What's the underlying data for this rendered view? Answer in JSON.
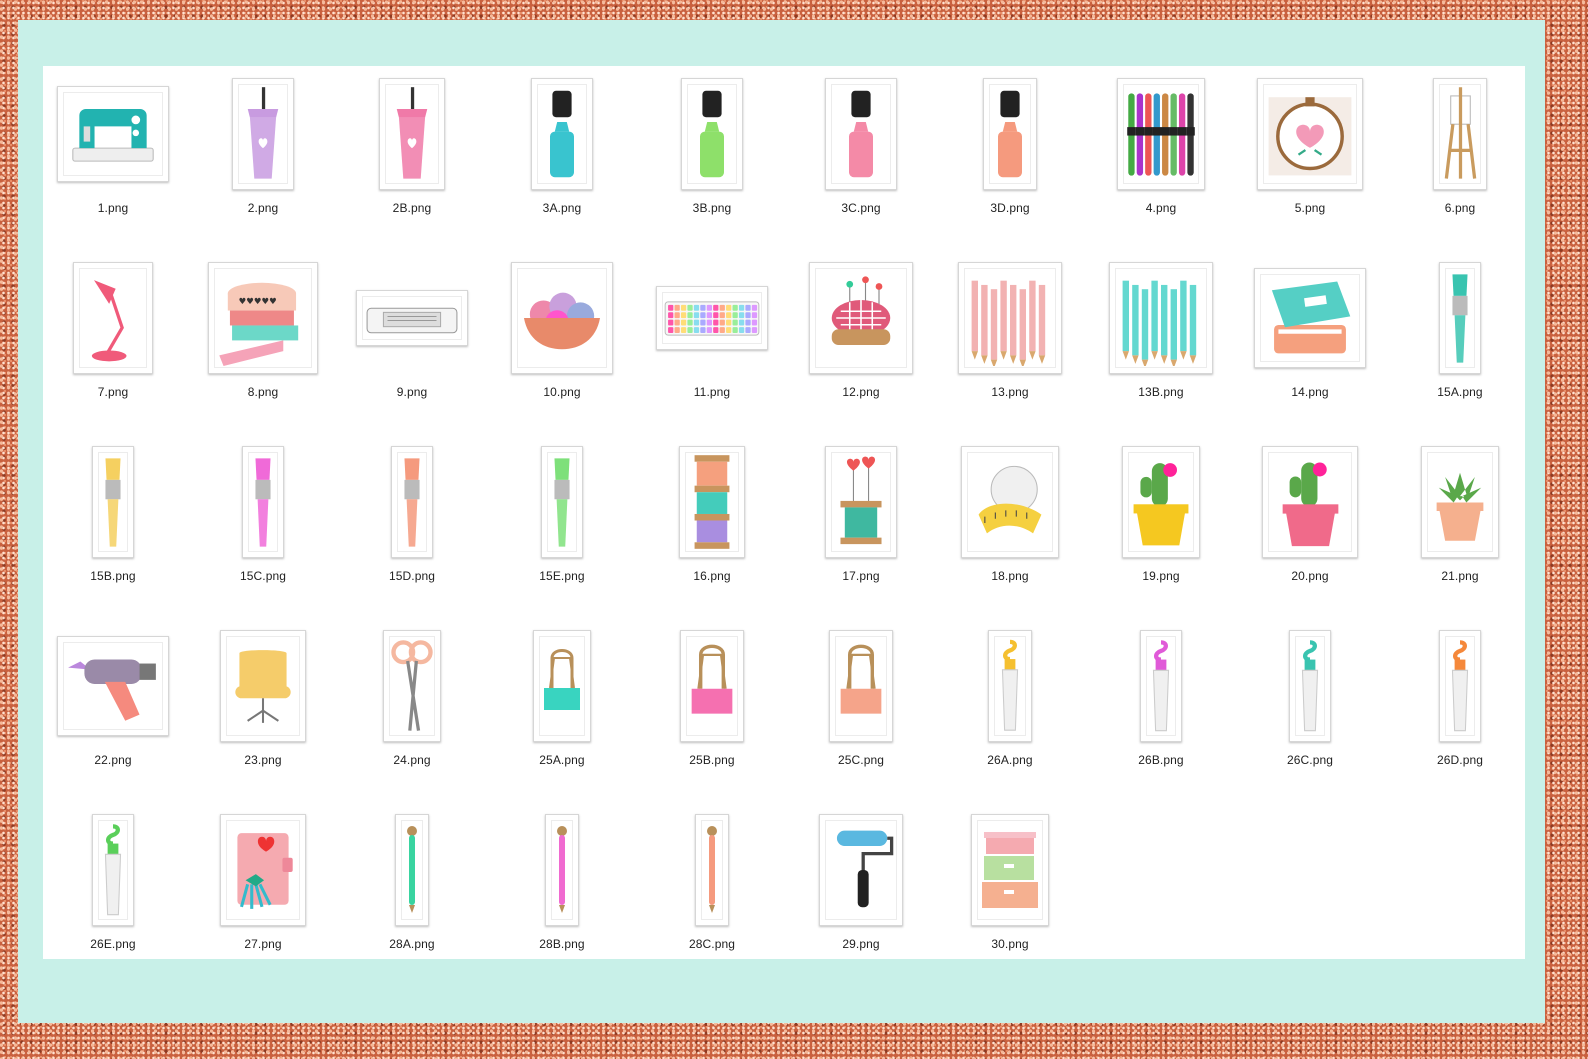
{
  "files": [
    {
      "name": "1.png",
      "icon": "sewing-machine-icon",
      "w": 112,
      "h": 96,
      "c": "#22b3b0"
    },
    {
      "name": "2.png",
      "icon": "cup-icon",
      "w": 62,
      "h": 112,
      "c": "#c89be0"
    },
    {
      "name": "2B.png",
      "icon": "cup-icon",
      "w": 66,
      "h": 112,
      "c": "#f07aa8"
    },
    {
      "name": "3A.png",
      "icon": "highlighter-icon",
      "w": 62,
      "h": 112,
      "c": "#39c4cf"
    },
    {
      "name": "3B.png",
      "icon": "highlighter-icon",
      "w": 62,
      "h": 112,
      "c": "#8ee06a"
    },
    {
      "name": "3C.png",
      "icon": "highlighter-icon",
      "w": 72,
      "h": 112,
      "c": "#f48aa7"
    },
    {
      "name": "3D.png",
      "icon": "highlighter-icon",
      "w": 54,
      "h": 112,
      "c": "#f59a7e"
    },
    {
      "name": "4.png",
      "icon": "embroidery-floss-icon",
      "w": 88,
      "h": 112,
      "c": "#9a6fc2"
    },
    {
      "name": "5.png",
      "icon": "embroidery-hoop-icon",
      "w": 106,
      "h": 112,
      "c": "#f39ab8"
    },
    {
      "name": "6.png",
      "icon": "easel-icon",
      "w": 54,
      "h": 112,
      "c": "#c99b5e"
    },
    {
      "name": "7.png",
      "icon": "desk-lamp-icon",
      "w": 80,
      "h": 112,
      "c": "#f05a7a"
    },
    {
      "name": "8.png",
      "icon": "washi-tape-icon",
      "w": 110,
      "h": 112,
      "c": "#f5a3b8"
    },
    {
      "name": "9.png",
      "icon": "cutting-machine-icon",
      "w": 112,
      "h": 56,
      "c": "#cccccc"
    },
    {
      "name": "10.png",
      "icon": "yarn-bowl-icon",
      "w": 102,
      "h": 112,
      "c": "#c9a0dc"
    },
    {
      "name": "11.png",
      "icon": "keyboard-icon",
      "w": 112,
      "h": 64,
      "c": "#b9d8f0"
    },
    {
      "name": "12.png",
      "icon": "pincushion-icon",
      "w": 104,
      "h": 112,
      "c": "#e05a7a"
    },
    {
      "name": "13.png",
      "icon": "pencils-icon",
      "w": 104,
      "h": 112,
      "c": "#f2b2b2"
    },
    {
      "name": "13B.png",
      "icon": "pencils-icon",
      "w": 104,
      "h": 112,
      "c": "#64d8d0"
    },
    {
      "name": "14.png",
      "icon": "planner-books-icon",
      "w": 112,
      "h": 100,
      "c": "#55cfc5"
    },
    {
      "name": "15A.png",
      "icon": "paintbrush-icon",
      "w": 42,
      "h": 112,
      "c": "#39c4b0"
    },
    {
      "name": "15B.png",
      "icon": "paintbrush-icon",
      "w": 42,
      "h": 112,
      "c": "#f5d060"
    },
    {
      "name": "15C.png",
      "icon": "paintbrush-icon",
      "w": 42,
      "h": 112,
      "c": "#f06ad8"
    },
    {
      "name": "15D.png",
      "icon": "paintbrush-icon",
      "w": 42,
      "h": 112,
      "c": "#f59a7e"
    },
    {
      "name": "15E.png",
      "icon": "paintbrush-icon",
      "w": 42,
      "h": 112,
      "c": "#7ee07a"
    },
    {
      "name": "16.png",
      "icon": "thread-spools-icon",
      "w": 66,
      "h": 112,
      "c": "#f5a07e"
    },
    {
      "name": "17.png",
      "icon": "thread-spool-icon",
      "w": 72,
      "h": 112,
      "c": "#3fb8a0"
    },
    {
      "name": "18.png",
      "icon": "measuring-tape-icon",
      "w": 98,
      "h": 112,
      "c": "#f5d040"
    },
    {
      "name": "19.png",
      "icon": "cactus-pot-icon",
      "w": 78,
      "h": 112,
      "c": "#f5c820"
    },
    {
      "name": "20.png",
      "icon": "cactus-pot-icon",
      "w": 96,
      "h": 112,
      "c": "#f06a8a"
    },
    {
      "name": "21.png",
      "icon": "succulent-pot-icon",
      "w": 78,
      "h": 112,
      "c": "#f5b08e"
    },
    {
      "name": "22.png",
      "icon": "glue-gun-icon",
      "w": 112,
      "h": 100,
      "c": "#f58a7e"
    },
    {
      "name": "23.png",
      "icon": "office-chair-icon",
      "w": 86,
      "h": 112,
      "c": "#f5cc6a"
    },
    {
      "name": "24.png",
      "icon": "scissors-icon",
      "w": 58,
      "h": 112,
      "c": "#f5b8a0"
    },
    {
      "name": "25A.png",
      "icon": "binder-clip-icon",
      "w": 58,
      "h": 112,
      "c": "#39d4c0"
    },
    {
      "name": "25B.png",
      "icon": "binder-clip-icon",
      "w": 64,
      "h": 112,
      "c": "#f570b0"
    },
    {
      "name": "25C.png",
      "icon": "binder-clip-icon",
      "w": 64,
      "h": 112,
      "c": "#f5a48a"
    },
    {
      "name": "26A.png",
      "icon": "paint-tube-icon",
      "w": 44,
      "h": 112,
      "c": "#f5c030"
    },
    {
      "name": "26B.png",
      "icon": "paint-tube-icon",
      "w": 42,
      "h": 112,
      "c": "#e05ad8"
    },
    {
      "name": "26C.png",
      "icon": "paint-tube-icon",
      "w": 42,
      "h": 112,
      "c": "#39c4b0"
    },
    {
      "name": "26D.png",
      "icon": "paint-tube-icon",
      "w": 42,
      "h": 112,
      "c": "#f5883a"
    },
    {
      "name": "26E.png",
      "icon": "paint-tube-icon",
      "w": 42,
      "h": 112,
      "c": "#5acf5a"
    },
    {
      "name": "27.png",
      "icon": "planner-tassels-icon",
      "w": 86,
      "h": 112,
      "c": "#f5aab0"
    },
    {
      "name": "28A.png",
      "icon": "pen-icon",
      "w": 34,
      "h": 112,
      "c": "#39d4a0"
    },
    {
      "name": "28B.png",
      "icon": "pen-icon",
      "w": 34,
      "h": 112,
      "c": "#f06ad0"
    },
    {
      "name": "28C.png",
      "icon": "pen-icon",
      "w": 34,
      "h": 112,
      "c": "#f59a7e"
    },
    {
      "name": "29.png",
      "icon": "paint-roller-icon",
      "w": 84,
      "h": 112,
      "c": "#5ab8e0"
    },
    {
      "name": "30.png",
      "icon": "storage-boxes-icon",
      "w": 78,
      "h": 112,
      "c": "#f5aab0"
    }
  ]
}
